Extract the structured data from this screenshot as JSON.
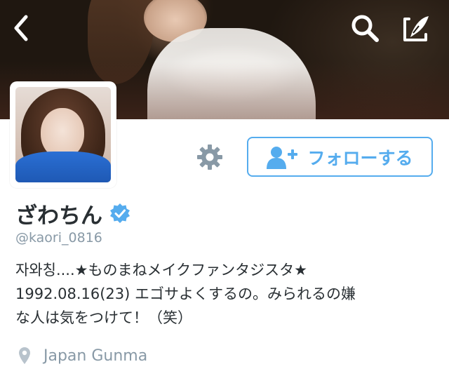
{
  "header": {
    "back_icon": "chevron-left-icon",
    "search_icon": "search-icon",
    "compose_icon": "compose-tweet-icon"
  },
  "profile": {
    "name": "ざわちん",
    "verified_icon": "verified-badge-icon",
    "handle": "@kaori_0816",
    "bio_lines": [
      "자와칭....★ものまねメイクファンタジスタ★",
      "1992.08.16(23) エゴサよくするの。みられるの嫌",
      "な人は気をつけて！（笑）"
    ],
    "location": "Japan Gunma"
  },
  "actions": {
    "settings_icon": "gear-icon",
    "follow_label": "フォローする",
    "follow_icon": "add-user-icon"
  },
  "colors": {
    "accent": "#55acee",
    "text": "#292f33",
    "muted": "#8899a6",
    "icon_gray": "#8899a6"
  }
}
